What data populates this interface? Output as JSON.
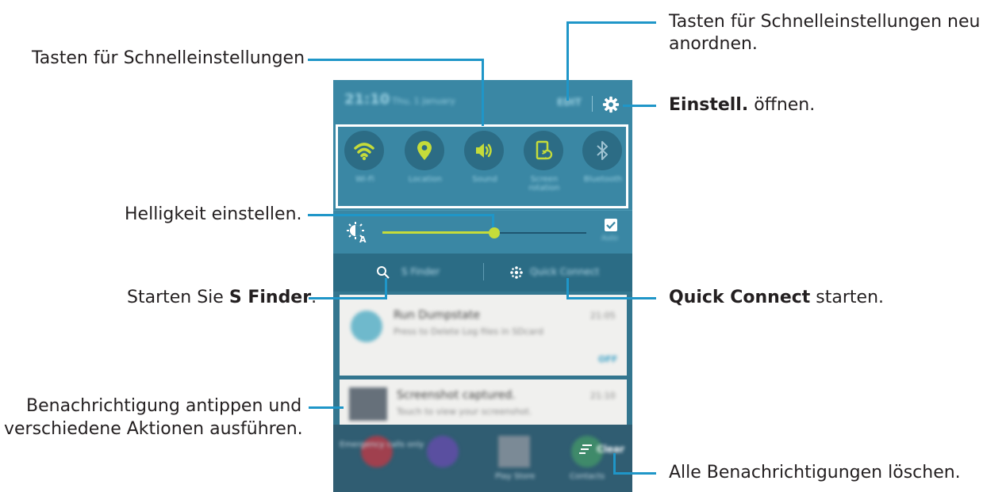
{
  "callouts": {
    "rearrange_line1": "Tasten für Schnelleinstellungen neu",
    "rearrange_line2": "anordnen.",
    "qs_buttons": "Tasten für Schnelleinstellungen",
    "open_settings_bold": "Einstell.",
    "open_settings_rest": " öffnen.",
    "brightness": "Helligkeit einstellen.",
    "sfinder_pre": "Starten Sie ",
    "sfinder_bold": "S Finder",
    "sfinder_post": ".",
    "quick_connect_bold": "Quick Connect",
    "quick_connect_rest": " starten.",
    "notif_line1": "Benachrichtigung antippen und",
    "notif_line2": "verschiedene Aktionen ausführen.",
    "clear_all": "Alle Benachrichtigungen löschen."
  },
  "phone": {
    "status": {
      "time": "21:10",
      "date": "Thu, 1 January",
      "edit": "EDIT"
    },
    "quick_settings": [
      {
        "label": "Wi-Fi",
        "icon": "wifi-icon",
        "active": true
      },
      {
        "label": "Location",
        "icon": "location-icon",
        "active": true
      },
      {
        "label": "Sound",
        "icon": "sound-icon",
        "active": true
      },
      {
        "label": "Screen rotation",
        "icon": "screen-rotation-icon",
        "active": true
      },
      {
        "label": "Bluetooth",
        "icon": "bluetooth-icon",
        "active": false
      }
    ],
    "brightness": {
      "level": 0.55,
      "auto_label": "Auto"
    },
    "search": {
      "sfinder": "S Finder",
      "quick_connect": "Quick Connect"
    },
    "notifications": [
      {
        "title": "Run Dumpstate",
        "subtitle": "Press to Delete Log files in SDcard",
        "time": "21:05",
        "action": "OFF"
      },
      {
        "title": "Screenshot captured.",
        "subtitle": "Touch to view your screenshot.",
        "time": "21:10"
      }
    ],
    "apps": [
      "Emergency calls only",
      "",
      "Play Store",
      "Contacts"
    ],
    "clear_label": "Clear"
  },
  "colors": {
    "callout_line": "#1f96c8",
    "accent": "#c5dc3a"
  }
}
